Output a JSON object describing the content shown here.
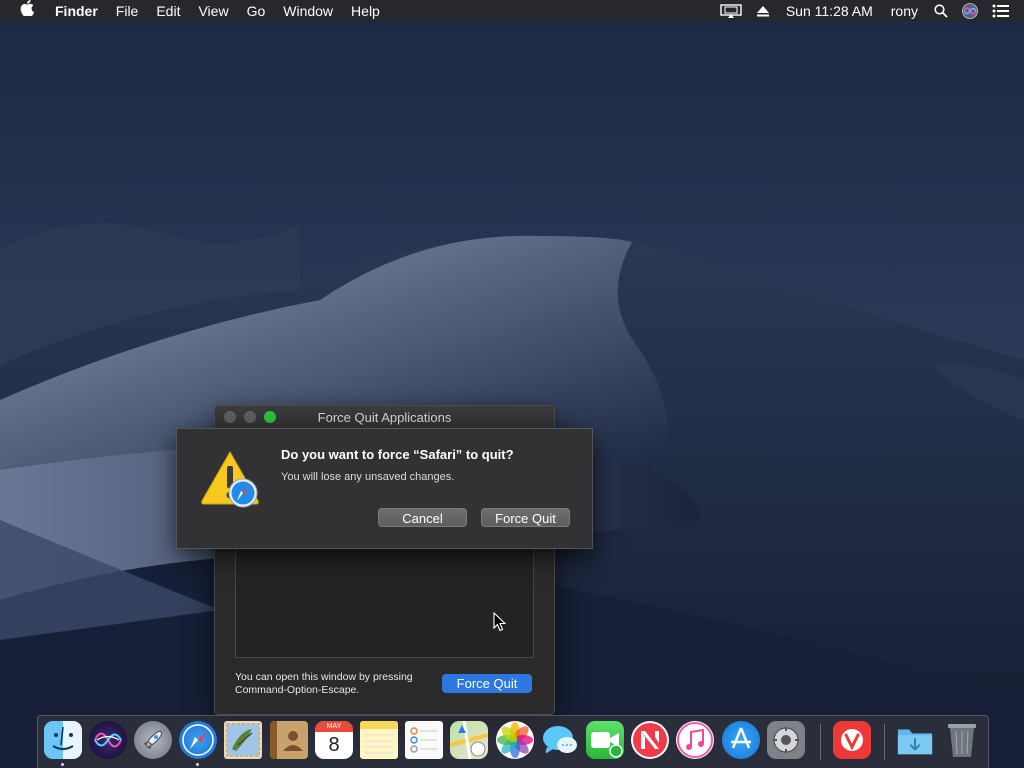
{
  "menubar": {
    "apple_icon": "apple-logo-icon",
    "app_name": "Finder",
    "menus": [
      "File",
      "Edit",
      "View",
      "Go",
      "Window",
      "Help"
    ],
    "status_icons": [
      "airplay-display-icon",
      "eject-icon"
    ],
    "clock": "Sun 11:28 AM",
    "user": "rony",
    "trailing_icons": [
      "spotlight-search-icon",
      "siri-icon",
      "notification-center-icon"
    ]
  },
  "force_quit_window": {
    "title": "Force Quit Applications",
    "hint": "You can open this window by pressing Command-Option-Escape.",
    "button": "Force Quit"
  },
  "alert": {
    "title": "Do you want to force “Safari” to quit?",
    "message": "You will lose any unsaved changes.",
    "cancel": "Cancel",
    "confirm": "Force Quit",
    "icon": "caution-safari-icon"
  },
  "dock": {
    "apps": [
      {
        "name": "finder",
        "running": true
      },
      {
        "name": "siri",
        "running": false
      },
      {
        "name": "launchpad",
        "running": false
      },
      {
        "name": "safari",
        "running": true
      },
      {
        "name": "mail",
        "running": false
      },
      {
        "name": "contacts",
        "running": false
      },
      {
        "name": "calendar",
        "running": false,
        "month": "MAY",
        "day": "8"
      },
      {
        "name": "notes",
        "running": false
      },
      {
        "name": "reminders",
        "running": false
      },
      {
        "name": "maps",
        "running": false
      },
      {
        "name": "photos",
        "running": false
      },
      {
        "name": "messages",
        "running": false
      },
      {
        "name": "facetime",
        "running": false
      },
      {
        "name": "news",
        "running": false
      },
      {
        "name": "itunes",
        "running": false
      },
      {
        "name": "app-store",
        "running": false
      },
      {
        "name": "system-preferences",
        "running": false
      },
      {
        "name": "vivaldi",
        "running": false
      },
      {
        "name": "downloads-folder",
        "running": false
      },
      {
        "name": "trash",
        "running": false
      }
    ]
  },
  "colors": {
    "accent": "#2d77e0",
    "close": "#5f5f61",
    "minimize": "#5f5f61",
    "zoom": "#2cc23a"
  }
}
